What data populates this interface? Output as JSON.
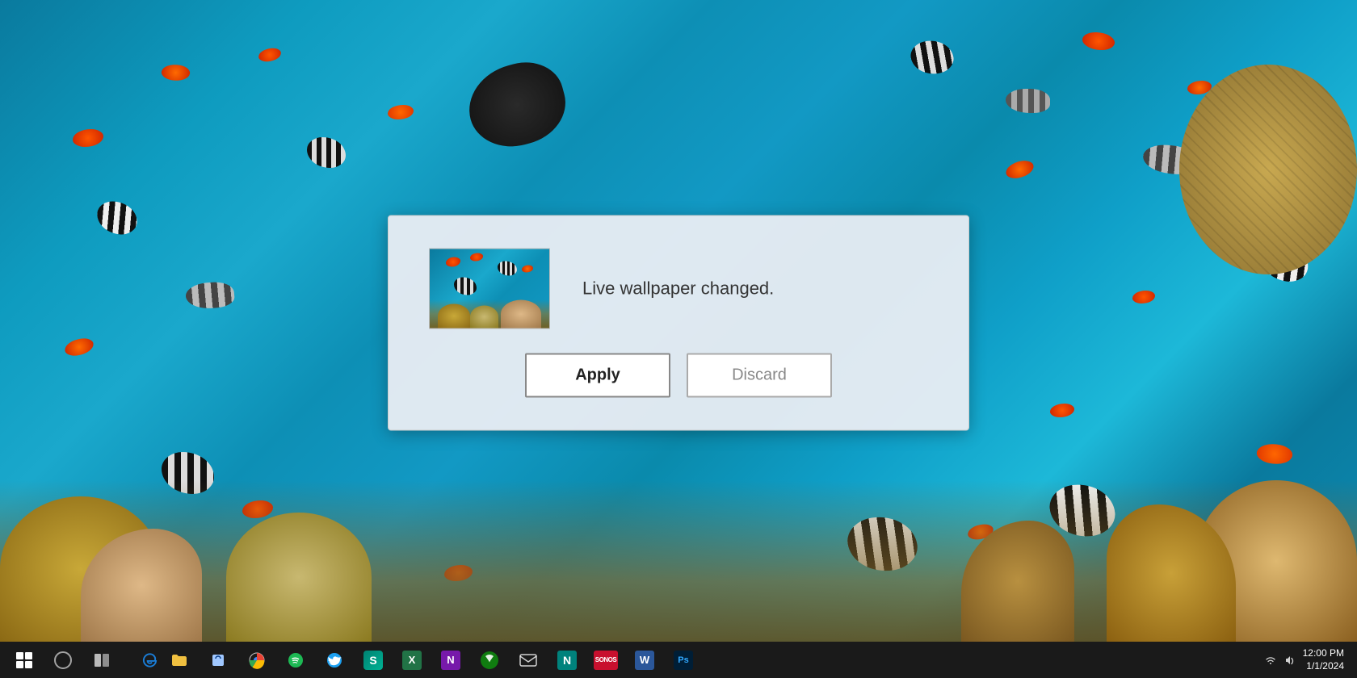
{
  "background": {
    "alt": "Underwater coral reef scene with tropical fish"
  },
  "dialog": {
    "message": "Live wallpaper changed.",
    "thumbnail_alt": "Coral reef thumbnail",
    "apply_label": "Apply",
    "discard_label": "Discard"
  },
  "taskbar": {
    "items": [
      {
        "name": "windows-start",
        "label": "Start",
        "icon": "win"
      },
      {
        "name": "cortana",
        "label": "Search",
        "icon": "circle"
      },
      {
        "name": "task-view",
        "label": "Task View",
        "icon": "taskview"
      },
      {
        "name": "edge",
        "label": "Microsoft Edge",
        "icon": "e"
      },
      {
        "name": "file-explorer",
        "label": "File Explorer",
        "icon": "folder"
      },
      {
        "name": "store",
        "label": "Microsoft Store",
        "icon": "bag"
      },
      {
        "name": "chrome",
        "label": "Google Chrome",
        "icon": "chrome"
      },
      {
        "name": "spotify",
        "label": "Spotify",
        "icon": "spotify"
      },
      {
        "name": "twitter",
        "label": "Twitter",
        "icon": "twitter"
      },
      {
        "name": "sway",
        "label": "Sway",
        "icon": "S"
      },
      {
        "name": "excel",
        "label": "Excel",
        "icon": "X"
      },
      {
        "name": "onenote",
        "label": "OneNote",
        "icon": "N"
      },
      {
        "name": "xbox",
        "label": "Xbox",
        "icon": "xbox"
      },
      {
        "name": "email",
        "label": "Mail",
        "icon": "mail"
      },
      {
        "name": "notepad",
        "label": "Notepad",
        "icon": "N"
      },
      {
        "name": "sonos",
        "label": "Sonos",
        "icon": "SONOS"
      },
      {
        "name": "word",
        "label": "Word",
        "icon": "W"
      },
      {
        "name": "photoshop",
        "label": "Photoshop",
        "icon": "Ps"
      }
    ],
    "tray": {
      "time": "12:00 PM",
      "date": "1/1/2024"
    }
  }
}
